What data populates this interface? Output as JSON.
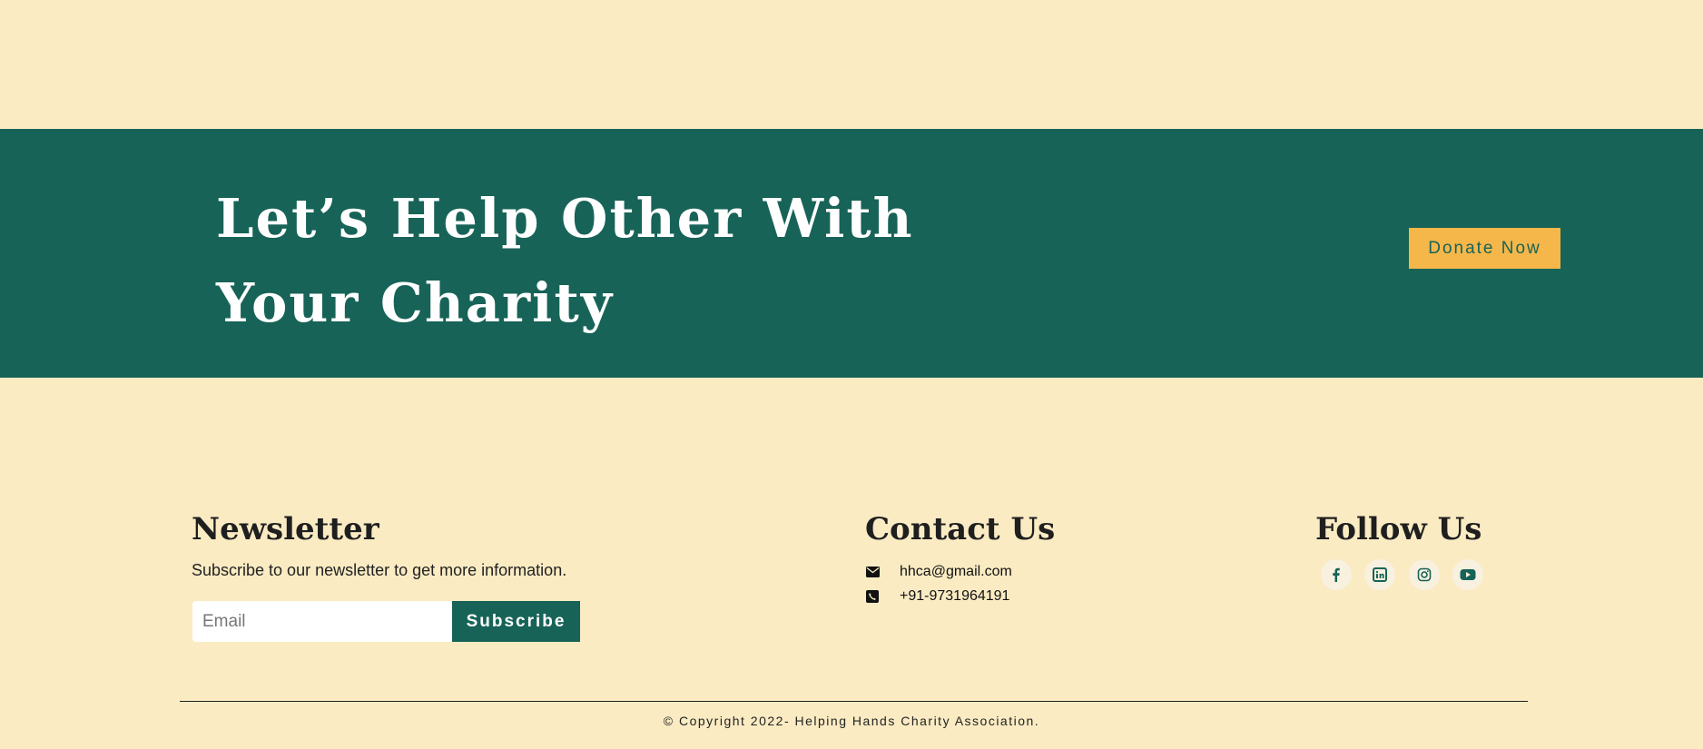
{
  "cta": {
    "title": "Let’s Help Other With Your Charity",
    "donate_label": "Donate Now"
  },
  "newsletter": {
    "heading": "Newsletter",
    "text": "Subscribe to our newsletter to get more information.",
    "email_placeholder": "Email",
    "subscribe_label": "Subscribe"
  },
  "contact": {
    "heading": "Contact Us",
    "email": "hhca@gmail.com",
    "phone": "+91-9731964191",
    "email_icon": "envelope-icon",
    "phone_icon": "phone-square-icon"
  },
  "follow": {
    "heading": "Follow Us",
    "icons": [
      "facebook-icon",
      "linkedin-icon",
      "instagram-icon",
      "youtube-icon"
    ]
  },
  "footer": {
    "copyright": "© Copyright 2022- Helping Hands Charity Association."
  },
  "colors": {
    "background": "#FAEBC3",
    "primary": "#176357",
    "accent": "#F5B74A"
  }
}
